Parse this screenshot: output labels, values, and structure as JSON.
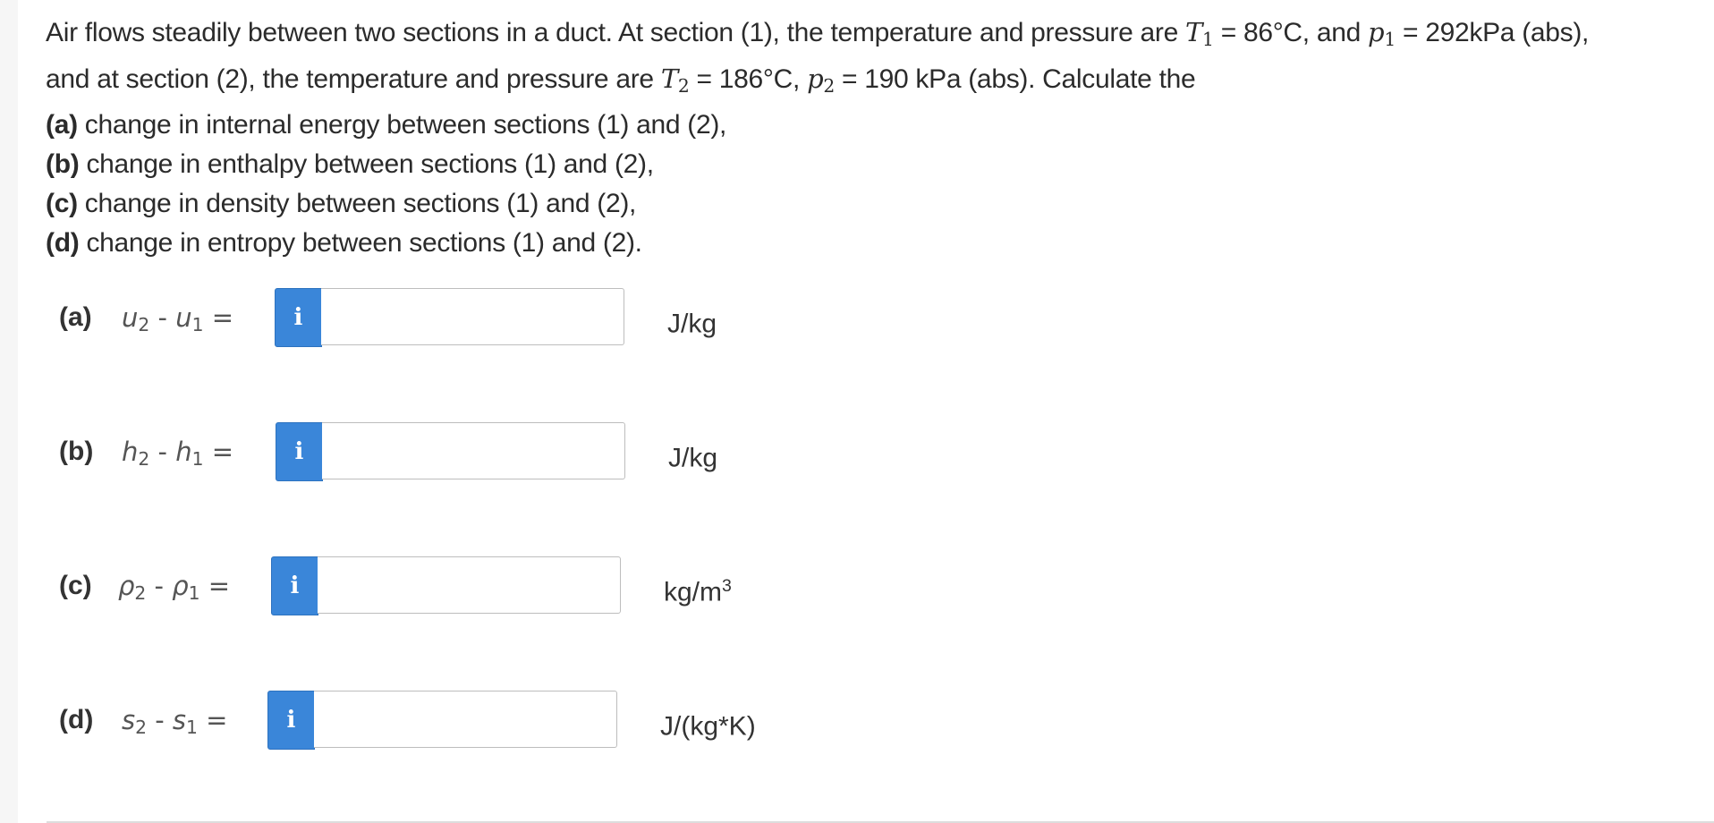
{
  "question": {
    "intro_1a": "Air flows steadily between two sections in a duct. At section (1), the temperature and pressure are ",
    "T1_sym": "T",
    "T1_sub": "1",
    "T1_val": " = 86°C, and ",
    "p1_sym": "p",
    "p1_sub": "1",
    "p1_val": " = 292kPa (abs),",
    "intro_2a": "and at section (2), the temperature and pressure are ",
    "T2_sym": "T",
    "T2_sub": "2",
    "T2_val": " = 186°C, ",
    "p2_sym": "p",
    "p2_sub": "2",
    "p2_val": " = 190 kPa (abs). Calculate the",
    "items": [
      {
        "label": "(a)",
        "text": " change in internal energy between sections (1) and (2),"
      },
      {
        "label": "(b)",
        "text": " change in enthalpy between sections (1) and (2),"
      },
      {
        "label": "(c)",
        "text": " change in density between sections (1) and (2),"
      },
      {
        "label": "(d)",
        "text": " change in entropy between sections (1) and (2)."
      }
    ]
  },
  "answers": [
    {
      "label": "(a)",
      "var_a": "u",
      "sub_a": "2",
      "minus": " - ",
      "var_b": "u",
      "sub_b": "1",
      "equals": " =",
      "info": "i",
      "value": "",
      "unit": "J/kg",
      "unit_sup": ""
    },
    {
      "label": "(b)",
      "var_a": "h",
      "sub_a": "2",
      "minus": " - ",
      "var_b": "h",
      "sub_b": "1",
      "equals": " =",
      "info": "i",
      "value": "",
      "unit": "J/kg",
      "unit_sup": ""
    },
    {
      "label": "(c)",
      "var_a": "ρ",
      "sub_a": "2",
      "minus": " - ",
      "var_b": "ρ",
      "sub_b": "1",
      "equals": " =",
      "info": "i",
      "value": "",
      "unit": "kg/m",
      "unit_sup": "3"
    },
    {
      "label": "(d)",
      "var_a": "s",
      "sub_a": "2",
      "minus": " - ",
      "var_b": "s",
      "sub_b": "1",
      "equals": " =",
      "info": "i",
      "value": "",
      "unit": "J/(kg*K)",
      "unit_sup": ""
    }
  ],
  "colors": {
    "info_button": "#3a86d9",
    "input_border": "#bdbdbd",
    "text": "#2b2b2b"
  }
}
